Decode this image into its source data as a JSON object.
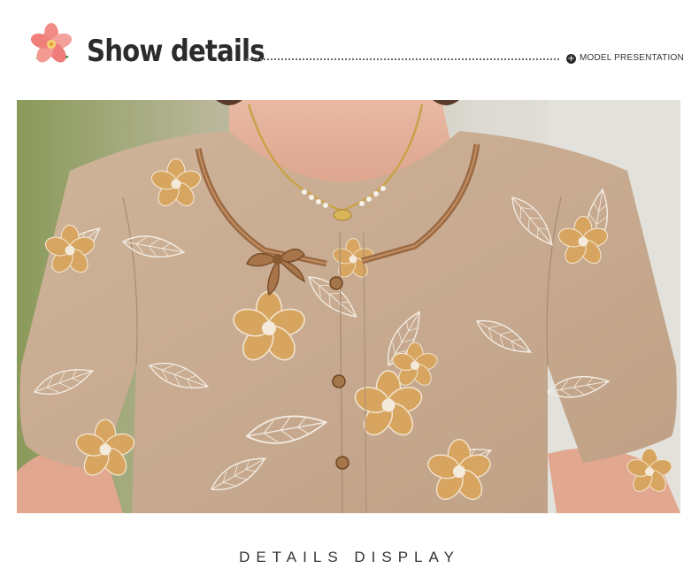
{
  "header": {
    "title": "Show details",
    "subtitle_icon": "plus-circle-icon",
    "subtitle": "MODEL PRESENTATION",
    "logo_icon": "pink-flower-icon"
  },
  "photo": {
    "subject": "product-photo"
  },
  "footer": {
    "caption": "DETAILS DISPLAY"
  },
  "colors": {
    "fabric": "#c9ab90",
    "flower_gold": "#d6a45e",
    "trim_brown": "#9a6a43",
    "title_text": "#2b2b2b"
  }
}
